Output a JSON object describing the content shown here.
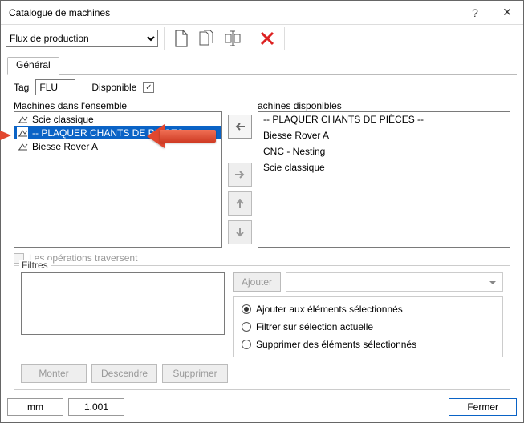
{
  "titlebar": {
    "title": "Catalogue de machines"
  },
  "toolbar": {
    "dropdown_value": "Flux de production"
  },
  "tab": {
    "general": "Général"
  },
  "general": {
    "tag_label": "Tag",
    "tag_value": "FLU",
    "disponible_label": "Disponible",
    "disponible_checked": "✓",
    "ensemble_header": "Machines dans l'ensemble",
    "ensemble_items": [
      "Scie classique",
      "-- PLAQUER CHANTS DE PIÈCES --",
      "Biesse Rover A"
    ],
    "disponibles_header": "achines disponibles",
    "disponibles_items": [
      "-- PLAQUER CHANTS DE PIÈCES --",
      "Biesse Rover A",
      "CNC - Nesting",
      "Scie classique"
    ],
    "ops_traversent": "Les opérations traversent"
  },
  "filtres": {
    "legend": "Filtres",
    "ajouter": "Ajouter",
    "radio1": "Ajouter aux éléments sélectionnés",
    "radio2": "Filtrer sur sélection actuelle",
    "radio3": "Supprimer des éléments sélectionnés",
    "monter": "Monter",
    "descendre": "Descendre",
    "supprimer": "Supprimer"
  },
  "status": {
    "unit": "mm",
    "scale": "1.001",
    "close": "Fermer"
  }
}
